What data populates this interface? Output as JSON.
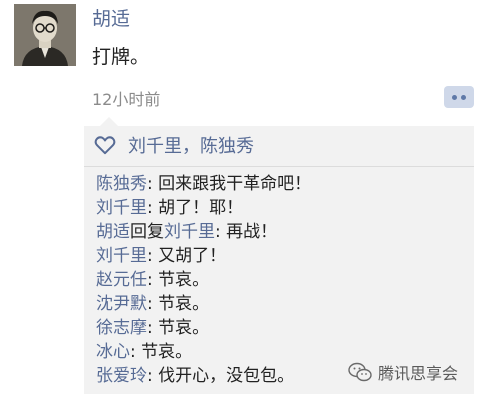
{
  "post": {
    "author": "胡适",
    "text": "打牌。",
    "time": "12小时前"
  },
  "likes": {
    "names": "刘千里，陈独秀"
  },
  "comments": [
    {
      "author": "陈独秀",
      "text": ": 回来跟我干革命吧！"
    },
    {
      "author": "刘千里",
      "text": ": 胡了！耶！"
    },
    {
      "author": "胡适",
      "reply_word": "回复",
      "reply_to": "刘千里",
      "text": ": 再战！"
    },
    {
      "author": "刘千里",
      "text": ": 又胡了！"
    },
    {
      "author": "赵元任",
      "text": ": 节哀。"
    },
    {
      "author": "沈尹默",
      "text": ": 节哀。"
    },
    {
      "author": "徐志摩",
      "text": ": 节哀。"
    },
    {
      "author": "冰心",
      "text": ": 节哀。"
    },
    {
      "author": "张爱玲",
      "text": ": 伐开心，没包包。"
    }
  ],
  "watermark": {
    "text": "腾讯思享会",
    "icon": "wechat-icon"
  },
  "colors": {
    "link": "#576b95",
    "panel": "#f2f2f2",
    "text": "#222222",
    "time": "#8b8b8b"
  }
}
